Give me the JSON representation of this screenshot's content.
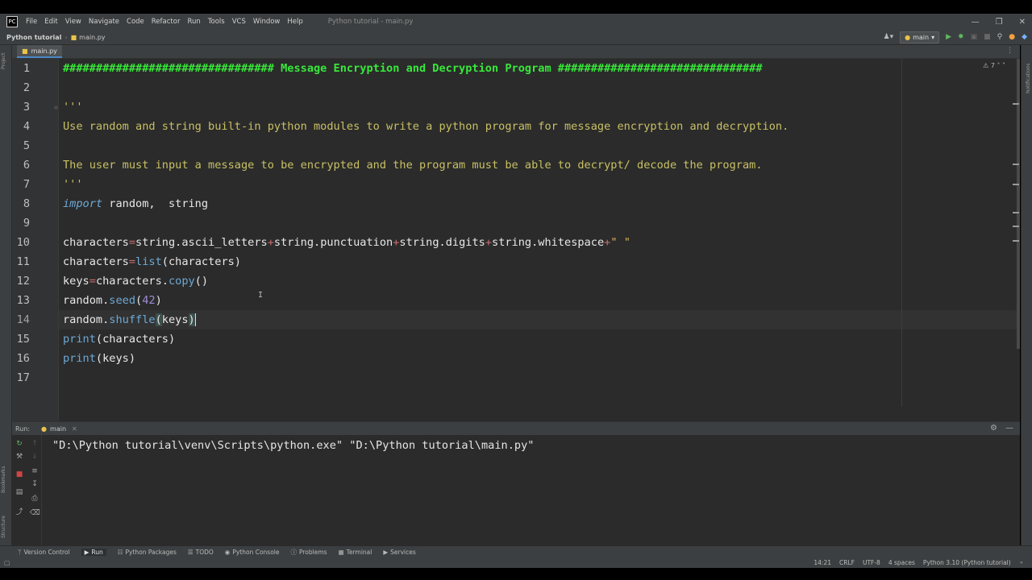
{
  "window": {
    "logo": "PC",
    "menu": [
      "File",
      "Edit",
      "View",
      "Navigate",
      "Code",
      "Refactor",
      "Run",
      "Tools",
      "VCS",
      "Window",
      "Help"
    ],
    "title": "Python tutorial - main.py",
    "controls": [
      "minimize-icon",
      "restore-icon",
      "close-icon"
    ]
  },
  "navbar": {
    "project": "Python tutorial",
    "file": "main.py",
    "run_config": "main",
    "icons": [
      "user-icon",
      "run-icon",
      "debug-icon",
      "coverage-icon",
      "stop-icon",
      "search-icon",
      "update-icon",
      "jetbrains-icon"
    ]
  },
  "left_strip": [
    "Project",
    "Bookmarks",
    "Structure"
  ],
  "right_strip": [
    "Notifications"
  ],
  "editor": {
    "tab_label": "main.py",
    "inspection_count": "7",
    "current_line": 14,
    "line_numbers": [
      "1",
      "2",
      "3",
      "4",
      "5",
      "6",
      "7",
      "8",
      "9",
      "10",
      "11",
      "12",
      "13",
      "14",
      "15",
      "16",
      "17"
    ],
    "lines": {
      "l1": "################################ Message Encryption and Decryption Program ###############################",
      "l3": "'''",
      "l4": "Use random and string built-in python modules to write a python program for message encryption and decryption.",
      "l6": "The user must input a message to be encrypted and the program must be able to decrypt/ decode the program.",
      "l7": "'''",
      "l8_kw": "import",
      "l8_rest": " random,  string",
      "l10_a": "characters",
      "l10_b": "=",
      "l10_c": "string.ascii_letters",
      "l10_d": "+",
      "l10_e": "string.punctuation",
      "l10_f": "+",
      "l10_g": "string.digits",
      "l10_h": "+",
      "l10_i": "string.whitespace",
      "l10_j": "+",
      "l10_k": "\" \"",
      "l11_a": "characters",
      "l11_b": "=",
      "l11_c": "list",
      "l11_d": "(characters)",
      "l12_a": "keys",
      "l12_b": "=",
      "l12_c": "characters.",
      "l12_d": "copy",
      "l12_e": "()",
      "l13_a": "random.",
      "l13_b": "seed",
      "l13_c": "(",
      "l13_d": "42",
      "l13_e": ")",
      "l14_a": "random.",
      "l14_b": "shuffle",
      "l14_c": "(",
      "l14_d": "keys",
      "l14_e": ")",
      "l15_a": "print",
      "l15_b": "(characters)",
      "l16_a": "print",
      "l16_b": "(keys)"
    }
  },
  "run": {
    "label": "Run:",
    "tab": "main",
    "console_line": "\"D:\\Python tutorial\\venv\\Scripts\\python.exe\" \"D:\\Python tutorial\\main.py\"",
    "toolbar_icons": [
      "rerun-icon",
      "up-icon",
      "wrench-icon",
      "down-icon",
      "stop-icon",
      "soft-wrap-icon",
      "layout-icon",
      "scroll-end-icon",
      "pin-icon",
      "print-icon",
      "trash-icon"
    ]
  },
  "tool_windows": [
    "Version Control",
    "Run",
    "Python Packages",
    "TODO",
    "Python Console",
    "Problems",
    "Terminal",
    "Services"
  ],
  "status": {
    "position": "14:21",
    "line_sep": "CRLF",
    "encoding": "UTF-8",
    "indent": "4 spaces",
    "interpreter": "Python 3.10 (Python tutorial)"
  }
}
